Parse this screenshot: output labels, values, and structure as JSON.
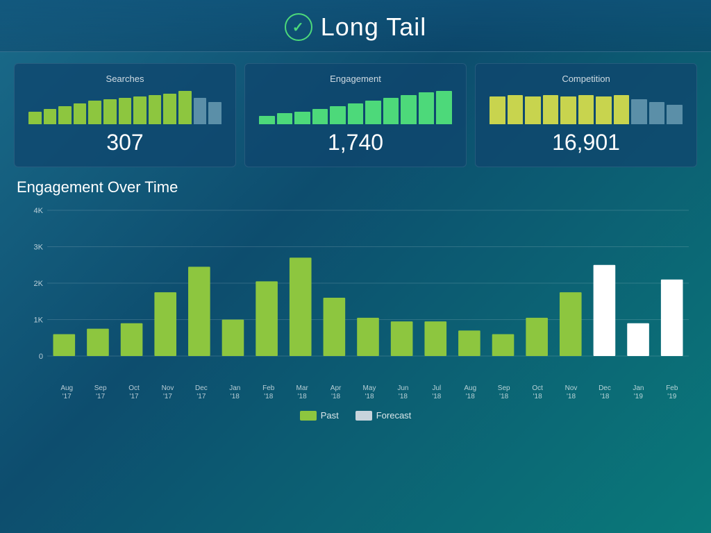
{
  "header": {
    "title": "Long Tail",
    "check_icon": "✓"
  },
  "cards": [
    {
      "id": "searches",
      "label": "Searches",
      "value": "307",
      "bars": [
        {
          "height": 18,
          "color": "#8dc63f"
        },
        {
          "height": 22,
          "color": "#8dc63f"
        },
        {
          "height": 26,
          "color": "#8dc63f"
        },
        {
          "height": 30,
          "color": "#8dc63f"
        },
        {
          "height": 34,
          "color": "#8dc63f"
        },
        {
          "height": 36,
          "color": "#8dc63f"
        },
        {
          "height": 38,
          "color": "#8dc63f"
        },
        {
          "height": 40,
          "color": "#8dc63f"
        },
        {
          "height": 42,
          "color": "#8dc63f"
        },
        {
          "height": 44,
          "color": "#8dc63f"
        },
        {
          "height": 48,
          "color": "#8dc63f"
        },
        {
          "height": 38,
          "color": "#5b8fa8"
        },
        {
          "height": 32,
          "color": "#5b8fa8"
        }
      ]
    },
    {
      "id": "engagement",
      "label": "Engagement",
      "value": "1,740",
      "bars": [
        {
          "height": 12,
          "color": "#4dd97a"
        },
        {
          "height": 16,
          "color": "#4dd97a"
        },
        {
          "height": 18,
          "color": "#4dd97a"
        },
        {
          "height": 22,
          "color": "#4dd97a"
        },
        {
          "height": 26,
          "color": "#4dd97a"
        },
        {
          "height": 30,
          "color": "#4dd97a"
        },
        {
          "height": 34,
          "color": "#4dd97a"
        },
        {
          "height": 38,
          "color": "#4dd97a"
        },
        {
          "height": 42,
          "color": "#4dd97a"
        },
        {
          "height": 46,
          "color": "#4dd97a"
        },
        {
          "height": 48,
          "color": "#4dd97a"
        }
      ]
    },
    {
      "id": "competition",
      "label": "Competition",
      "value": "16,901",
      "bars": [
        {
          "height": 40,
          "color": "#c8d44e"
        },
        {
          "height": 42,
          "color": "#c8d44e"
        },
        {
          "height": 40,
          "color": "#c8d44e"
        },
        {
          "height": 42,
          "color": "#c8d44e"
        },
        {
          "height": 40,
          "color": "#c8d44e"
        },
        {
          "height": 42,
          "color": "#c8d44e"
        },
        {
          "height": 40,
          "color": "#c8d44e"
        },
        {
          "height": 42,
          "color": "#c8d44e"
        },
        {
          "height": 36,
          "color": "#5b8fa8"
        },
        {
          "height": 32,
          "color": "#5b8fa8"
        },
        {
          "height": 28,
          "color": "#5b8fa8"
        }
      ]
    }
  ],
  "chart": {
    "title": "Engagement Over Time",
    "y_labels": [
      "4K",
      "3K",
      "2K",
      "1K",
      "0"
    ],
    "x_labels": [
      {
        "line1": "Aug",
        "line2": "'17"
      },
      {
        "line1": "Sep",
        "line2": "'17"
      },
      {
        "line1": "Oct",
        "line2": "'17"
      },
      {
        "line1": "Nov",
        "line2": "'17"
      },
      {
        "line1": "Dec",
        "line2": "'17"
      },
      {
        "line1": "Jan",
        "line2": "'18"
      },
      {
        "line1": "Feb",
        "line2": "'18"
      },
      {
        "line1": "Mar",
        "line2": "'18"
      },
      {
        "line1": "Apr",
        "line2": "'18"
      },
      {
        "line1": "May",
        "line2": "'18"
      },
      {
        "line1": "Jun",
        "line2": "'18"
      },
      {
        "line1": "Jul",
        "line2": "'18"
      },
      {
        "line1": "Aug",
        "line2": "'18"
      },
      {
        "line1": "Sep",
        "line2": "'18"
      },
      {
        "line1": "Oct",
        "line2": "'18"
      },
      {
        "line1": "Nov",
        "line2": "'18"
      },
      {
        "line1": "Dec",
        "line2": "'18"
      },
      {
        "line1": "Jan",
        "line2": "'19"
      },
      {
        "line1": "Feb",
        "line2": "'19"
      }
    ],
    "bars": [
      {
        "value": 600,
        "type": "past"
      },
      {
        "value": 750,
        "type": "past"
      },
      {
        "value": 900,
        "type": "past"
      },
      {
        "value": 1750,
        "type": "past"
      },
      {
        "value": 2450,
        "type": "past"
      },
      {
        "value": 1000,
        "type": "past"
      },
      {
        "value": 2050,
        "type": "past"
      },
      {
        "value": 2700,
        "type": "past"
      },
      {
        "value": 1600,
        "type": "past"
      },
      {
        "value": 1050,
        "type": "past"
      },
      {
        "value": 950,
        "type": "past"
      },
      {
        "value": 950,
        "type": "past"
      },
      {
        "value": 700,
        "type": "past"
      },
      {
        "value": 600,
        "type": "past"
      },
      {
        "value": 1050,
        "type": "past"
      },
      {
        "value": 1750,
        "type": "past"
      },
      {
        "value": 2500,
        "type": "forecast"
      },
      {
        "value": 900,
        "type": "forecast"
      },
      {
        "value": 2100,
        "type": "forecast"
      }
    ],
    "max_value": 4000,
    "past_color": "#8dc63f",
    "forecast_color": "#ffffff"
  },
  "legend": {
    "past_label": "Past",
    "forecast_label": "Forecast",
    "past_color": "#8dc63f",
    "forecast_color": "#c8d4dc"
  }
}
